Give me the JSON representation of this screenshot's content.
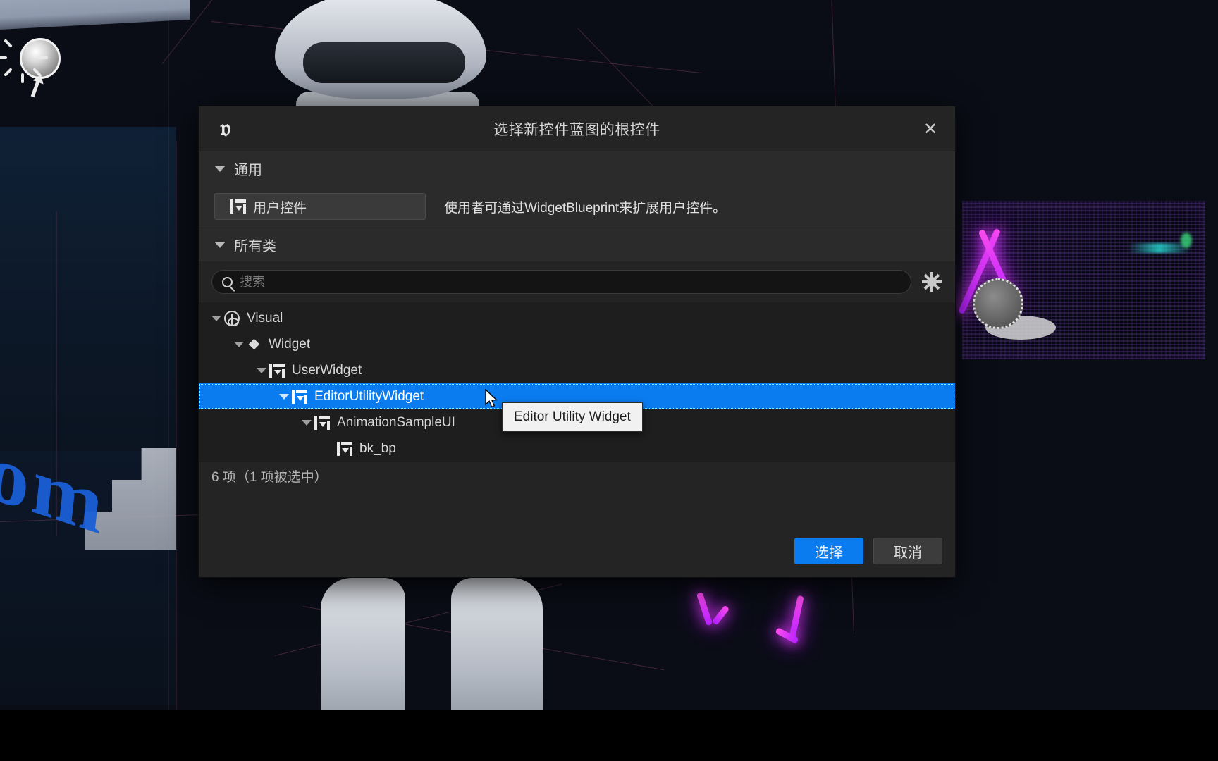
{
  "dialog": {
    "title": "选择新控件蓝图的根控件",
    "logo_icon": "unreal-engine-logo",
    "close_icon": "close-icon"
  },
  "sections": {
    "general": {
      "header": "通用",
      "item_label": "用户控件",
      "item_icon": "widget-icon",
      "description": "使用者可通过WidgetBlueprint来扩展用户控件。"
    },
    "all_classes": {
      "header": "所有类"
    }
  },
  "search": {
    "placeholder": "搜索",
    "value": "",
    "icon": "search-icon",
    "settings_icon": "gear-icon"
  },
  "tree": {
    "items": [
      {
        "label": "Visual",
        "indent": 0,
        "icon": "visual-class-icon",
        "expanded": true,
        "selected": false
      },
      {
        "label": "Widget",
        "indent": 1,
        "icon": "diamond-icon",
        "expanded": true,
        "selected": false
      },
      {
        "label": "UserWidget",
        "indent": 2,
        "icon": "widget-icon",
        "expanded": true,
        "selected": false
      },
      {
        "label": "EditorUtilityWidget",
        "indent": 3,
        "icon": "widget-icon",
        "expanded": true,
        "selected": true
      },
      {
        "label": "AnimationSampleUI",
        "indent": 4,
        "icon": "widget-icon",
        "expanded": true,
        "selected": false
      },
      {
        "label": "bk_bp",
        "indent": 5,
        "icon": "widget-icon",
        "expanded": false,
        "selected": false
      }
    ],
    "count_text": "6 项（1 项被选中）"
  },
  "tooltip": {
    "text": "Editor Utility Widget"
  },
  "footer": {
    "select_label": "选择",
    "cancel_label": "取消"
  },
  "colors": {
    "selection_blue": "#0a7cf0",
    "dialog_bg": "#242424",
    "tree_bg": "#1e1e1e",
    "neon_magenta": "#e03cf5",
    "floor_blue": "#1a5fd6"
  },
  "viewport": {
    "floor_text": "om"
  }
}
